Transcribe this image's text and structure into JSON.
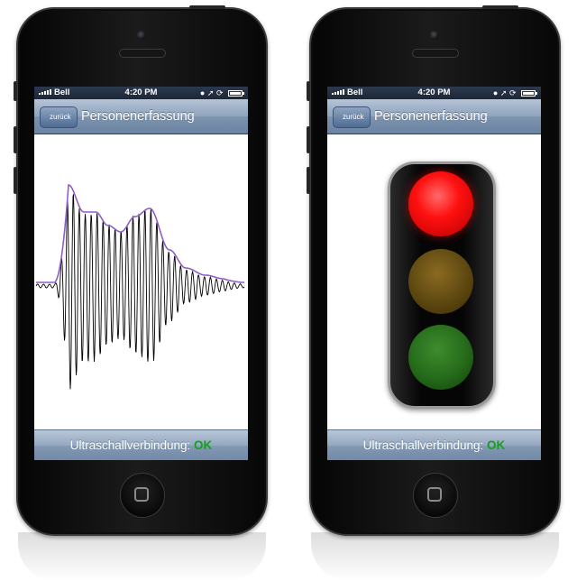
{
  "screens": [
    {
      "status_bar": {
        "carrier": "Bell",
        "time": "4:20 PM"
      },
      "nav": {
        "back_label": "zurück",
        "title": "Personenerfassung"
      },
      "footer": {
        "label": "Ultraschallverbindung:",
        "status": "OK"
      }
    },
    {
      "status_bar": {
        "carrier": "Bell",
        "time": "4:20 PM"
      },
      "nav": {
        "back_label": "zurück",
        "title": "Personenerfassung"
      },
      "footer": {
        "label": "Ultraschallverbindung:",
        "status": "OK"
      },
      "traffic_light": {
        "active": "red"
      }
    }
  ],
  "colors": {
    "signal_line": "#000000",
    "envelope_line": "#8f5fc8",
    "status_ok": "#14a11a",
    "nav_bar": "#7d93ae"
  },
  "icons": [
    "signal-bars-icon",
    "lock-rotation-icon",
    "location-arrow-icon",
    "alarm-icon",
    "battery-icon",
    "home-button-icon"
  ]
}
